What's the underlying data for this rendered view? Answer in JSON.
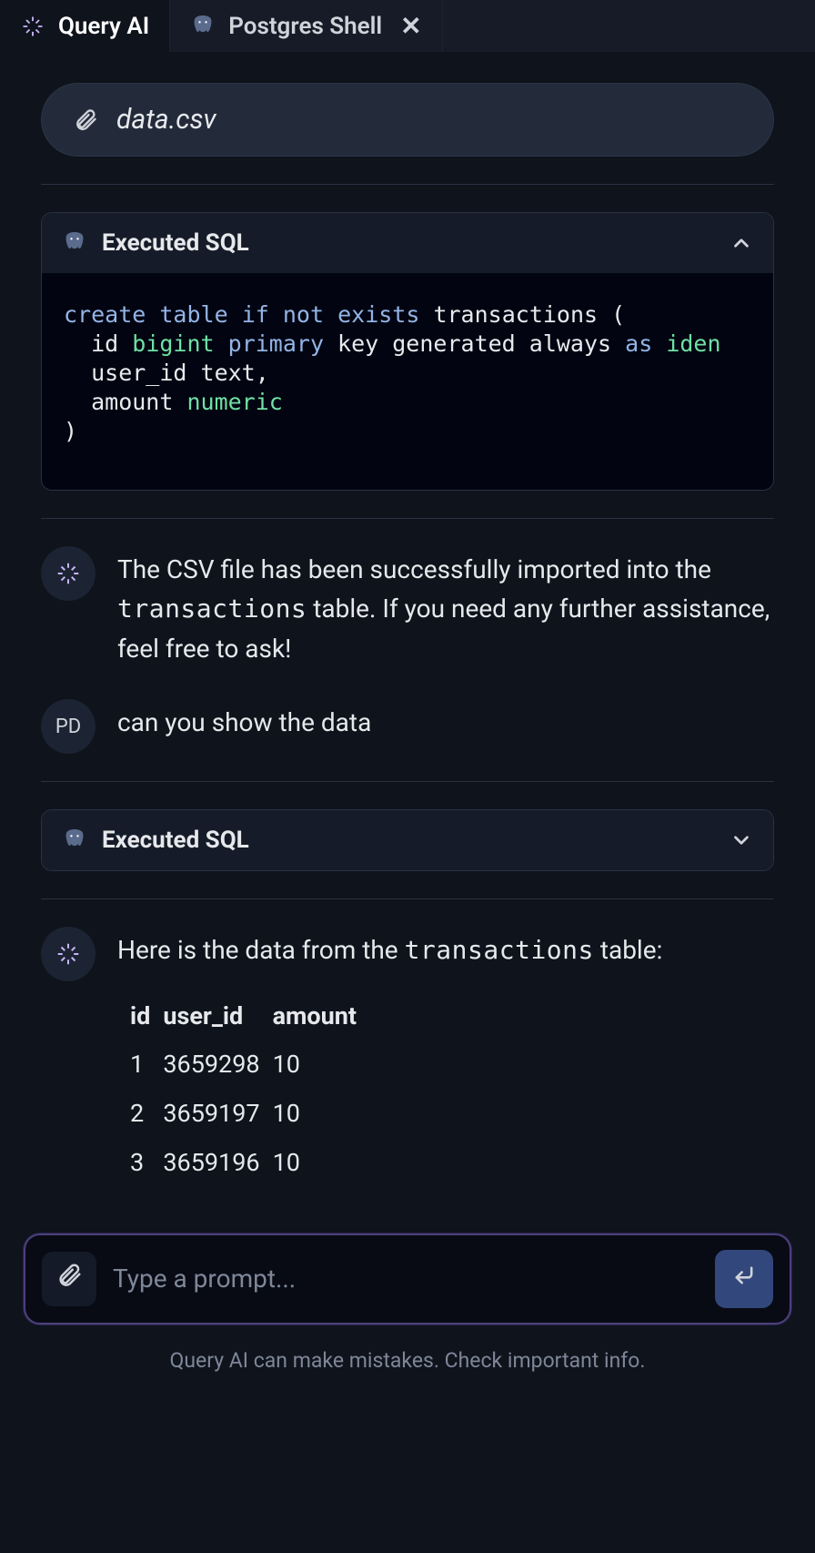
{
  "tabs": {
    "query_ai": "Query AI",
    "postgres_shell": "Postgres Shell"
  },
  "attachment": {
    "filename": "data.csv"
  },
  "exec1": {
    "label": "Executed SQL",
    "code_tokens": [
      [
        "kw",
        "create"
      ],
      [
        "sp",
        " "
      ],
      [
        "kw",
        "table"
      ],
      [
        "sp",
        " "
      ],
      [
        "kw",
        "if"
      ],
      [
        "sp",
        " "
      ],
      [
        "kw",
        "not"
      ],
      [
        "sp",
        " "
      ],
      [
        "kw",
        "exists"
      ],
      [
        "sp",
        " transactions ("
      ],
      [
        "nl"
      ],
      [
        "sp",
        "  id "
      ],
      [
        "ty",
        "bigint"
      ],
      [
        "sp",
        " "
      ],
      [
        "kw",
        "primary"
      ],
      [
        "sp",
        " key generated always "
      ],
      [
        "kw",
        "as"
      ],
      [
        "sp",
        " "
      ],
      [
        "ty",
        "iden"
      ],
      [
        "nl"
      ],
      [
        "sp",
        "  user_id text,"
      ],
      [
        "nl"
      ],
      [
        "sp",
        "  amount "
      ],
      [
        "ty",
        "numeric"
      ],
      [
        "nl"
      ],
      [
        "sp",
        ")"
      ]
    ]
  },
  "ai_msg1": {
    "pre": "The CSV file has been successfully imported into the ",
    "code": "transactions",
    "post": " table. If you need any further assistance, feel free to ask!"
  },
  "user": {
    "initials": "PD",
    "text": "can you show the data"
  },
  "exec2": {
    "label": "Executed SQL"
  },
  "ai_msg2": {
    "pre": "Here is the data from the ",
    "code": "transactions",
    "post": " table:",
    "headers": [
      "id",
      "user_id",
      "amount"
    ],
    "rows": [
      [
        "1",
        "3659298",
        "10"
      ],
      [
        "2",
        "3659197",
        "10"
      ],
      [
        "3",
        "3659196",
        "10"
      ]
    ]
  },
  "prompt": {
    "placeholder": "Type a prompt..."
  },
  "disclaimer": "Query AI can make mistakes. Check important info."
}
